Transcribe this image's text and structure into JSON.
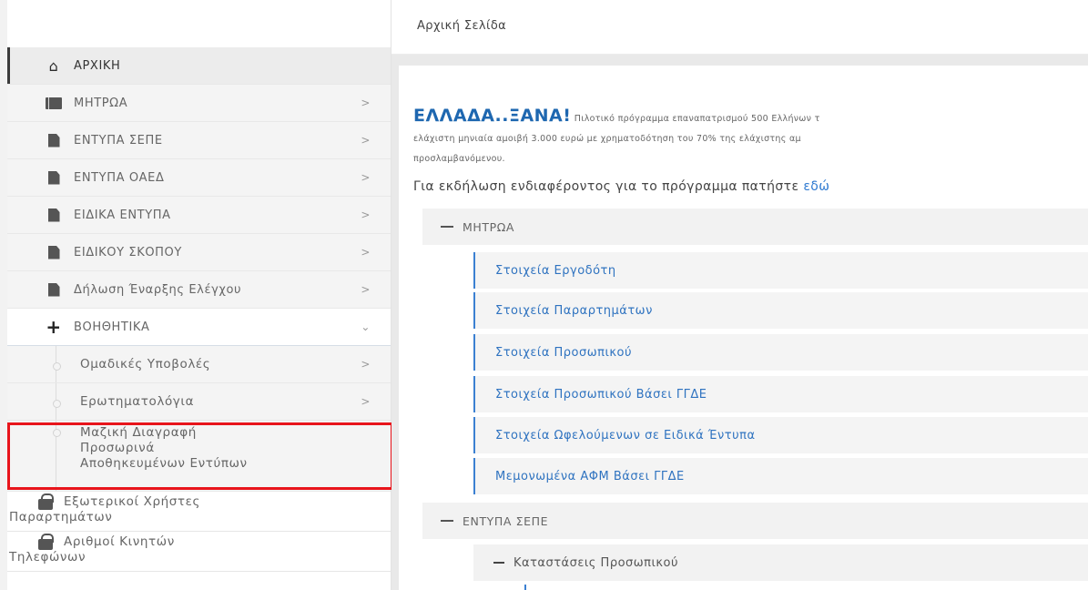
{
  "header": {
    "breadcrumb": "Αρχική Σελίδα"
  },
  "sidebar": {
    "items": [
      {
        "label": "ΑΡΧΙΚΗ",
        "icon": "home-icon",
        "chevron": ""
      },
      {
        "label": "ΜΗΤΡΩΑ",
        "icon": "book-icon",
        "chevron": ">"
      },
      {
        "label": "ΕΝΤΥΠΑ ΣΕΠΕ",
        "icon": "document-icon",
        "chevron": ">"
      },
      {
        "label": "ΕΝΤΥΠΑ ΟΑΕΔ",
        "icon": "document-icon",
        "chevron": ">"
      },
      {
        "label": "ΕΙΔΙΚΑ ΕΝΤΥΠΑ",
        "icon": "document-icon",
        "chevron": ">"
      },
      {
        "label": "ΕΙΔΙΚΟΥ ΣΚΟΠΟΥ",
        "icon": "document-icon",
        "chevron": ">"
      },
      {
        "label": "Δήλωση Έναρξης Ελέγχου",
        "icon": "document-icon",
        "chevron": ">"
      },
      {
        "label": "ΒΟΗΘΗΤΙΚΑ",
        "icon": "plus-icon",
        "chevron": "⌄"
      }
    ],
    "subitems": [
      {
        "label": "Ομαδικές Υποβολές",
        "chevron": ">"
      },
      {
        "label": "Ερωτηματολόγια",
        "chevron": ">"
      },
      {
        "label_lines": [
          "Μαζική Διαγραφή",
          "Προσωρινά",
          "Αποθηκευμένων Εντύπων"
        ]
      }
    ],
    "lock_items": [
      {
        "line1": "Εξωτερικοί Χρήστες",
        "line2": "Παραρτημάτων"
      },
      {
        "line1": "Αριθμοί Κινητών",
        "line2": "Τηλεφώνων"
      }
    ]
  },
  "main": {
    "promo": {
      "brand": "ΕΛΛΑΔΑ..ΞΑΝΑ!",
      "line1": "Πιλοτικό πρόγραμμα επαναπατρισμού 500 Ελλήνων τ",
      "line2": "ελάχιστη μηνιαία αμοιβή 3.000 ευρώ με χρηματοδότηση του 70% της ελάχιστης αμ",
      "line3": "προσλαμβανόμενου."
    },
    "interest_text": "Για εκδήλωση ενδιαφέροντος για το πρόγραμμα πατήστε ",
    "interest_link": "εδώ",
    "sections": [
      {
        "title": "ΜΗΤΡΩΑ",
        "links": [
          "Στοιχεία Εργοδότη",
          "Στοιχεία Παραρτημάτων",
          "Στοιχεία Προσωπικού",
          "Στοιχεία Προσωπικού Βάσει ΓΓΔΕ",
          "Στοιχεία Ωφελούμενων σε Ειδικά Έντυπα",
          "Μεμονωμένα ΑΦΜ Βάσει ΓΓΔΕ"
        ]
      },
      {
        "title": "ΕΝΤΥΠΑ ΣΕΠΕ",
        "subsection": "Καταστάσεις Προσωπικού"
      }
    ]
  },
  "colors": {
    "accent": "#1e67b0",
    "link": "#2f73c0",
    "highlight": "#e8141b"
  }
}
